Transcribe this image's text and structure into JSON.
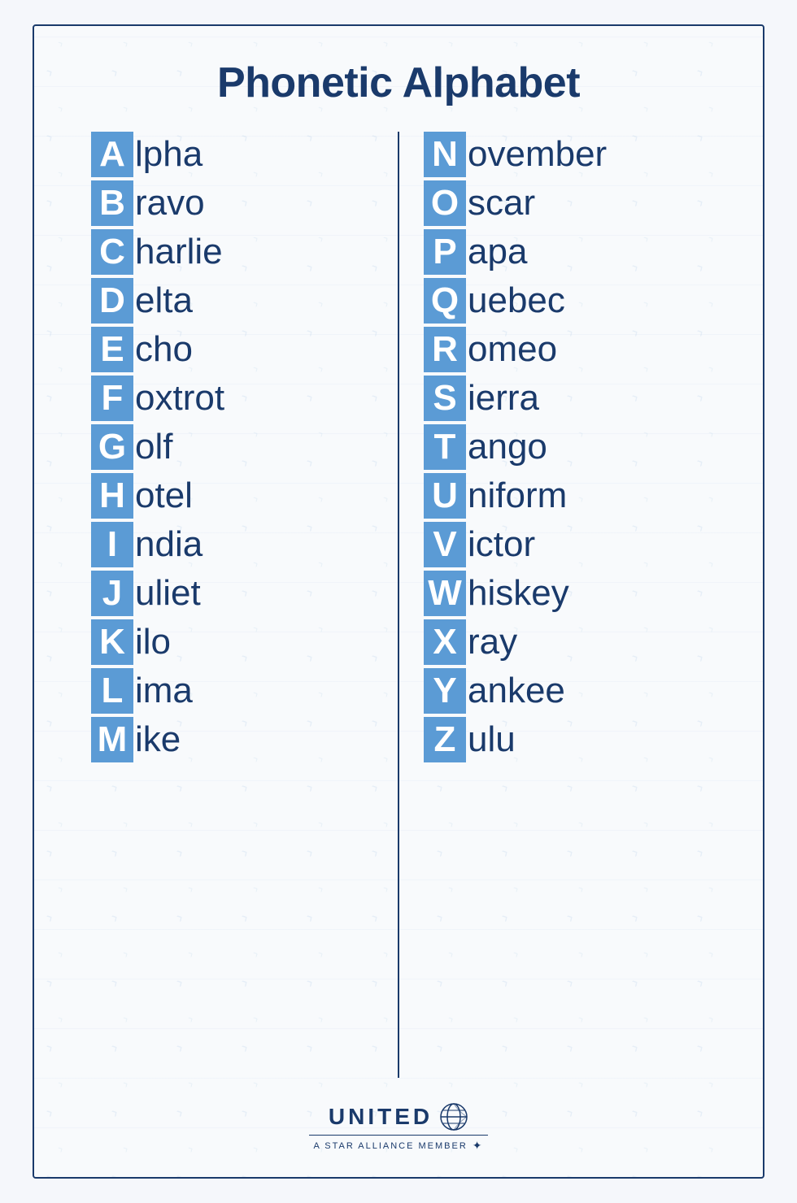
{
  "title": "Phonetic Alphabet",
  "left_column": [
    {
      "letter": "A",
      "rest": "lpha"
    },
    {
      "letter": "B",
      "rest": "ravo"
    },
    {
      "letter": "C",
      "rest": "harlie"
    },
    {
      "letter": "D",
      "rest": "elta"
    },
    {
      "letter": "E",
      "rest": "cho"
    },
    {
      "letter": "F",
      "rest": "oxtrot"
    },
    {
      "letter": "G",
      "rest": "olf"
    },
    {
      "letter": "H",
      "rest": "otel"
    },
    {
      "letter": "I",
      "rest": "ndia"
    },
    {
      "letter": "J",
      "rest": "uliet"
    },
    {
      "letter": "K",
      "rest": "ilo"
    },
    {
      "letter": "L",
      "rest": "ima"
    },
    {
      "letter": "M",
      "rest": "ike"
    }
  ],
  "right_column": [
    {
      "letter": "N",
      "rest": "ovember"
    },
    {
      "letter": "O",
      "rest": "scar"
    },
    {
      "letter": "P",
      "rest": "apa"
    },
    {
      "letter": "Q",
      "rest": "uebec"
    },
    {
      "letter": "R",
      "rest": "omeo"
    },
    {
      "letter": "S",
      "rest": "ierra"
    },
    {
      "letter": "T",
      "rest": "ango"
    },
    {
      "letter": "U",
      "rest": "niform"
    },
    {
      "letter": "V",
      "rest": "ictor"
    },
    {
      "letter": "W",
      "rest": "hiskey"
    },
    {
      "letter": "X",
      "rest": "ray"
    },
    {
      "letter": "Y",
      "rest": "ankee"
    },
    {
      "letter": "Z",
      "rest": "ulu"
    }
  ],
  "footer": {
    "brand": "UNITED",
    "tagline": "A STAR ALLIANCE MEMBER"
  }
}
